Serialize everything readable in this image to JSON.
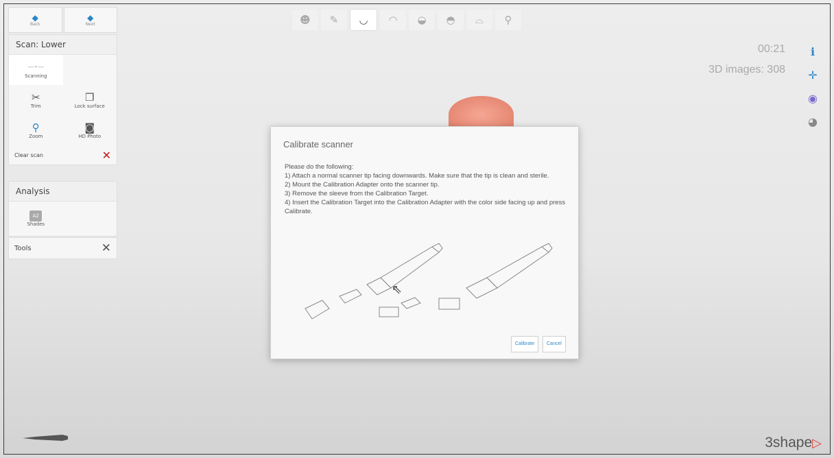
{
  "nav": {
    "back_label": "Back",
    "next_label": "Next"
  },
  "scan_panel": {
    "title": "Scan: Lower",
    "tools": [
      {
        "label": "Scanning",
        "icon": "scanner-tip-icon",
        "glyph": "—∘—"
      },
      {
        "label": "",
        "icon": "",
        "glyph": ""
      },
      {
        "label": "Trim",
        "icon": "scissors-icon",
        "glyph": "✂"
      },
      {
        "label": "Lock surface",
        "icon": "lock-surface-icon",
        "glyph": "❒"
      },
      {
        "label": "Zoom",
        "icon": "magnifier-icon",
        "glyph": "⚲"
      },
      {
        "label": "HD Photo",
        "icon": "camera-icon",
        "glyph": "◙"
      }
    ],
    "clear_label": "Clear scan"
  },
  "analysis_panel": {
    "title": "Analysis",
    "shades_label": "Shades",
    "shades_badge": "A2"
  },
  "tools_panel": {
    "title": "Tools"
  },
  "status": {
    "timer": "00:21",
    "images": "3D images: 308"
  },
  "dialog": {
    "title": "Calibrate scanner",
    "lines": [
      "Please do the following:",
      "1) Attach a normal scanner tip facing downwards. Make sure that the tip is clean and sterile.",
      "2) Mount the Calibration Adapter onto the scanner tip.",
      "3) Remove the sleeve from the Calibration Target.",
      "4) Insert the Calibration Target into the Calibration Adapter with the color side facing up and press Calibrate."
    ],
    "calibrate_label": "Calibrate",
    "cancel_label": "Cancel"
  },
  "logo": {
    "text": "3shape",
    "mark": "▷"
  },
  "colors": {
    "accent": "#2a86c8",
    "clear_x": "#c01a1a",
    "logo_mark": "#e2403a"
  }
}
